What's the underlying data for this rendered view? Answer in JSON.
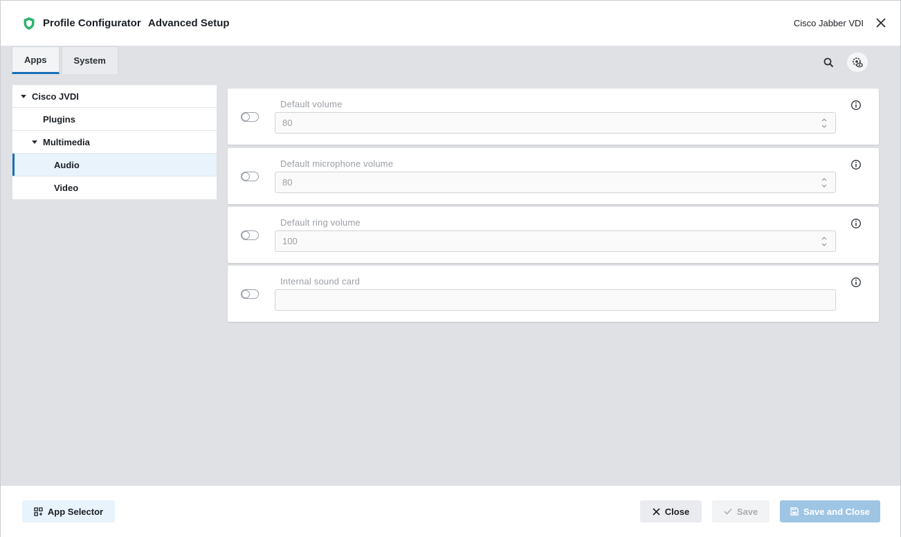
{
  "header": {
    "app_title": "Profile Configurator",
    "sub_title": "Advanced Setup",
    "product": "Cisco Jabber VDI"
  },
  "tabs": [
    {
      "label": "Apps",
      "active": true
    },
    {
      "label": "System",
      "active": false
    }
  ],
  "tree": [
    {
      "label": "Cisco JVDI",
      "expanded": true
    },
    {
      "label": "Plugins"
    },
    {
      "label": "Multimedia",
      "expanded": true
    },
    {
      "label": "Audio",
      "selected": true
    },
    {
      "label": "Video"
    }
  ],
  "settings": [
    {
      "label": "Default volume",
      "value": "80",
      "enabled": false
    },
    {
      "label": "Default microphone volume",
      "value": "80",
      "enabled": false
    },
    {
      "label": "Default ring volume",
      "value": "100",
      "enabled": false
    },
    {
      "label": "Internal sound card",
      "value": "",
      "enabled": false
    }
  ],
  "footer": {
    "app_selector": "App Selector",
    "close": "Close",
    "save": "Save",
    "save_and_close": "Save and Close"
  },
  "colors": {
    "accent": "#1570b8",
    "logo_green": "#2fb36b",
    "save_close_bg": "#9fc5e4"
  },
  "icons": [
    "shield-logo-icon",
    "close-icon",
    "search-icon",
    "settings-eye-icon",
    "info-icon",
    "app-selector-icon",
    "save-icon",
    "check-icon"
  ]
}
